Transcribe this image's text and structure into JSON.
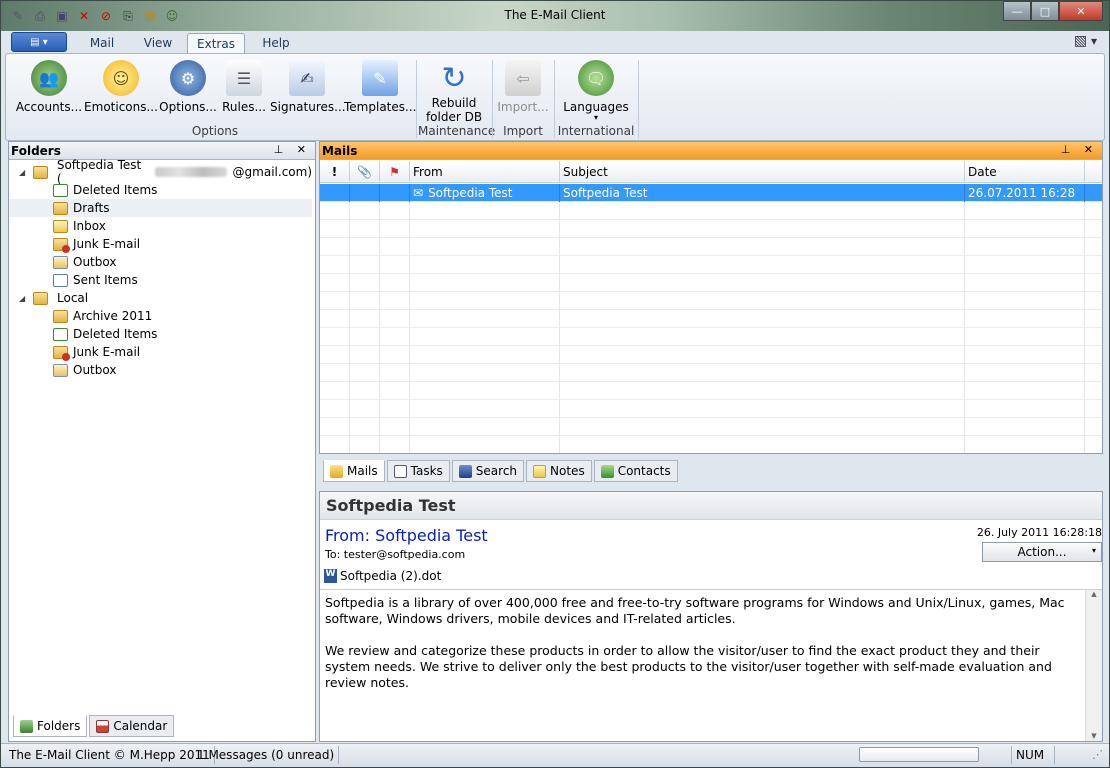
{
  "window": {
    "title": "The E-Mail Client",
    "controls": [
      "—",
      "□",
      "✕"
    ],
    "quick_access": [
      "edit-icon",
      "print-icon",
      "save-icon",
      "delete-icon",
      "stop-icon",
      "print-preview-icon",
      "notepad-icon",
      "contacts-icon"
    ]
  },
  "ribbon": {
    "app_button_glyph": "▤ ▾",
    "tabs": [
      {
        "label": "Mail"
      },
      {
        "label": "View"
      },
      {
        "label": "Extras",
        "active": true
      },
      {
        "label": "Help"
      }
    ],
    "right_glyph": "▾",
    "buttons": {
      "accounts": "Accounts...",
      "emoticons": "Emoticons...",
      "options": "Options...",
      "rules": "Rules...",
      "signatures": "Signatures...",
      "templates": "Templates...",
      "rebuild_line1": "Rebuild",
      "rebuild_line2": "folder DB",
      "import": "Import...",
      "languages": "Languages",
      "languages_dd": "▾"
    },
    "groups": {
      "options": "Options",
      "maintenance": "Maintenance",
      "import": "Import",
      "international": "International"
    }
  },
  "folders_panel": {
    "title": "Folders",
    "pin_close": "⊥ ✕",
    "tree": [
      {
        "label": "Softpedia Test (",
        "suffix": "@gmail.com)",
        "level": 0,
        "icon": "folder",
        "expanded": true
      },
      {
        "label": "Deleted Items",
        "level": 1,
        "icon": "trash"
      },
      {
        "label": "Drafts",
        "level": 1,
        "icon": "drafts",
        "selected": true
      },
      {
        "label": "Inbox",
        "level": 1,
        "icon": "inbox"
      },
      {
        "label": "Junk E-mail",
        "level": 1,
        "icon": "junk"
      },
      {
        "label": "Outbox",
        "level": 1,
        "icon": "outbox"
      },
      {
        "label": "Sent Items",
        "level": 1,
        "icon": "sent"
      },
      {
        "label": "Local",
        "level": 0,
        "icon": "folder",
        "expanded": true
      },
      {
        "label": "Archive 2011",
        "level": 1,
        "icon": "folder"
      },
      {
        "label": "Deleted Items",
        "level": 1,
        "icon": "trash"
      },
      {
        "label": "Junk E-mail",
        "level": 1,
        "icon": "junk"
      },
      {
        "label": "Outbox",
        "level": 1,
        "icon": "outbox"
      }
    ],
    "bottom_tabs": [
      "Folders",
      "Calendar"
    ]
  },
  "mails_panel": {
    "title": "Mails",
    "pin_close": "⊥ ✕",
    "columns": {
      "importance": "!",
      "attachment": "📎",
      "flag": "⚑",
      "from": "From",
      "subject": "Subject",
      "date": "Date"
    },
    "rows": [
      {
        "from": "Softpedia Test",
        "subject": "Softpedia Test",
        "date": "26.07.2011 16:28",
        "selected": true
      }
    ],
    "view_tabs": [
      "Mails",
      "Tasks",
      "Search",
      "Notes",
      "Contacts"
    ]
  },
  "preview": {
    "subject": "Softpedia Test",
    "from": "From: Softpedia Test",
    "to": "To: tester@softpedia.com",
    "date": "26. July 2011 16:28:18",
    "action_button": "Action...",
    "action_dd": "▾",
    "attachment_glyph": "W",
    "attachment": "Softpedia (2).dot",
    "body": [
      "Softpedia is a library of over 400,000 free and free-to-try software programs for Windows and Unix/Linux, games, Mac software, Windows drivers, mobile devices and IT-related articles.",
      "We review and categorize these products in order to allow the visitor/user to find the exact product they and their system needs. We strive to deliver only the best products to the visitor/user together with self-made evaluation and review notes."
    ],
    "scroll_up": "▲",
    "scroll_down": "▼"
  },
  "statusbar": {
    "copyright": "The E-Mail Client © M.Hepp 2011",
    "messages": "1 Messages (0 unread)",
    "num": "NUM",
    "grip": "⋰"
  },
  "colors": {
    "accent_orange": "#f59a25",
    "selection": "#3399ff",
    "from_blue": "#0a1fb5"
  }
}
